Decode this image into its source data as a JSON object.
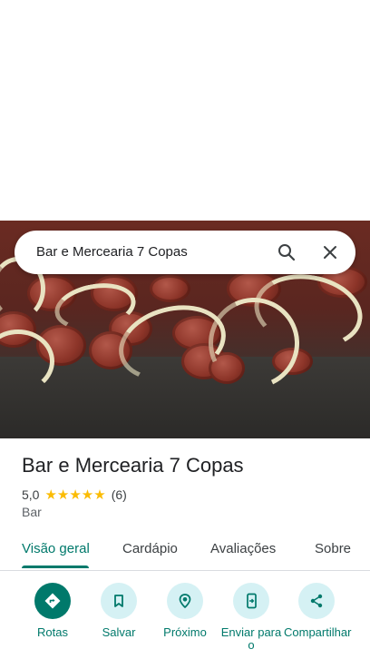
{
  "search": {
    "query": "Bar e Mercearia 7 Copas",
    "search_icon": "search-icon",
    "close_icon": "close-icon"
  },
  "place": {
    "name": "Bar e Mercearia 7 Copas",
    "rating": "5,0",
    "stars": "★★★★★",
    "reviews_count": "(6)",
    "category": "Bar",
    "rating_value": 5.0
  },
  "tabs": [
    {
      "label": "Visão geral",
      "active": true
    },
    {
      "label": "Cardápio"
    },
    {
      "label": "Avaliações"
    },
    {
      "label": "Sobre"
    }
  ],
  "actions": [
    {
      "label": "Rotas",
      "icon": "directions-icon"
    },
    {
      "label": "Salvar",
      "icon": "bookmark-icon"
    },
    {
      "label": "Próximo",
      "icon": "nearby-icon"
    },
    {
      "label": "Enviar para o",
      "icon": "send-to-phone-icon"
    },
    {
      "label": "Compartilhar",
      "icon": "share-icon"
    }
  ],
  "colors": {
    "accent": "#00796b",
    "action_bg": "#d5f1f4",
    "star": "#fbbc04"
  }
}
